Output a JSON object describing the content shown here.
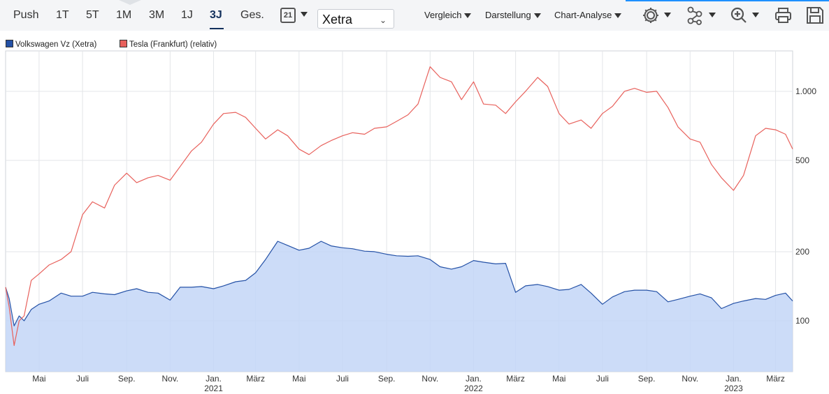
{
  "toolbar": {
    "ranges": [
      "Push",
      "1T",
      "5T",
      "1M",
      "3M",
      "1J",
      "3J",
      "Ges."
    ],
    "active_range": "3J",
    "calendar_day": "21",
    "exchange_select": "Xetra",
    "menus": [
      "Vergleich",
      "Darstellung",
      "Chart-Analyse"
    ]
  },
  "icons": [
    "calendar-icon",
    "settings-gear-icon",
    "indicators-icon",
    "zoom-icon",
    "print-icon",
    "save-icon"
  ],
  "colors": {
    "primary": "#2451a6",
    "comparison": "#e8615c",
    "area_fill": "#c3d6f7",
    "accent": "#1e90ff"
  },
  "chart_data": {
    "type": "line",
    "scale": "log",
    "grid": true,
    "legend_position": "top-left",
    "ylim": [
      60,
      1500
    ],
    "y_ticks": [
      100,
      200,
      500,
      1000
    ],
    "y_tick_labels": [
      "100",
      "200",
      "500",
      "1.000"
    ],
    "x_range": [
      "2020-03-15",
      "2023-03-25"
    ],
    "x_ticks": [
      {
        "date": "2020-05-01",
        "label": "Mai",
        "year": ""
      },
      {
        "date": "2020-07-01",
        "label": "Juli",
        "year": ""
      },
      {
        "date": "2020-09-01",
        "label": "Sep.",
        "year": ""
      },
      {
        "date": "2020-11-01",
        "label": "Nov.",
        "year": ""
      },
      {
        "date": "2021-01-01",
        "label": "Jan.",
        "year": "2021"
      },
      {
        "date": "2021-03-01",
        "label": "März",
        "year": ""
      },
      {
        "date": "2021-05-01",
        "label": "Mai",
        "year": ""
      },
      {
        "date": "2021-07-01",
        "label": "Juli",
        "year": ""
      },
      {
        "date": "2021-09-01",
        "label": "Sep.",
        "year": ""
      },
      {
        "date": "2021-11-01",
        "label": "Nov.",
        "year": ""
      },
      {
        "date": "2022-01-01",
        "label": "Jan.",
        "year": "2022"
      },
      {
        "date": "2022-03-01",
        "label": "März",
        "year": ""
      },
      {
        "date": "2022-05-01",
        "label": "Mai",
        "year": ""
      },
      {
        "date": "2022-07-01",
        "label": "Juli",
        "year": ""
      },
      {
        "date": "2022-09-01",
        "label": "Sep.",
        "year": ""
      },
      {
        "date": "2022-11-01",
        "label": "Nov.",
        "year": ""
      },
      {
        "date": "2023-01-01",
        "label": "Jan.",
        "year": "2023"
      },
      {
        "date": "2023-03-01",
        "label": "März",
        "year": ""
      }
    ],
    "series": [
      {
        "name": "Volkswagen Vz (Xetra)",
        "color": "#2451a6",
        "filled": true,
        "points": [
          [
            "2020-03-15",
            140
          ],
          [
            "2020-03-20",
            125
          ],
          [
            "2020-03-27",
            95
          ],
          [
            "2020-04-03",
            105
          ],
          [
            "2020-04-10",
            100
          ],
          [
            "2020-04-20",
            112
          ],
          [
            "2020-05-01",
            118
          ],
          [
            "2020-05-15",
            122
          ],
          [
            "2020-06-01",
            132
          ],
          [
            "2020-06-15",
            128
          ],
          [
            "2020-07-01",
            128
          ],
          [
            "2020-07-15",
            133
          ],
          [
            "2020-08-01",
            131
          ],
          [
            "2020-08-15",
            130
          ],
          [
            "2020-09-01",
            135
          ],
          [
            "2020-09-15",
            138
          ],
          [
            "2020-10-01",
            133
          ],
          [
            "2020-10-15",
            132
          ],
          [
            "2020-11-01",
            123
          ],
          [
            "2020-11-15",
            140
          ],
          [
            "2020-12-01",
            140
          ],
          [
            "2020-12-15",
            141
          ],
          [
            "2021-01-01",
            138
          ],
          [
            "2021-01-15",
            142
          ],
          [
            "2021-02-01",
            148
          ],
          [
            "2021-02-15",
            150
          ],
          [
            "2021-03-01",
            162
          ],
          [
            "2021-03-15",
            185
          ],
          [
            "2021-04-01",
            222
          ],
          [
            "2021-04-15",
            213
          ],
          [
            "2021-05-01",
            203
          ],
          [
            "2021-05-15",
            207
          ],
          [
            "2021-06-01",
            222
          ],
          [
            "2021-06-15",
            212
          ],
          [
            "2021-07-01",
            208
          ],
          [
            "2021-07-15",
            206
          ],
          [
            "2021-08-01",
            201
          ],
          [
            "2021-08-15",
            200
          ],
          [
            "2021-09-01",
            195
          ],
          [
            "2021-09-15",
            192
          ],
          [
            "2021-10-01",
            191
          ],
          [
            "2021-10-15",
            192
          ],
          [
            "2021-11-01",
            185
          ],
          [
            "2021-11-15",
            172
          ],
          [
            "2021-12-01",
            168
          ],
          [
            "2021-12-15",
            172
          ],
          [
            "2022-01-01",
            183
          ],
          [
            "2022-01-15",
            180
          ],
          [
            "2022-02-01",
            177
          ],
          [
            "2022-02-15",
            178
          ],
          [
            "2022-03-01",
            133
          ],
          [
            "2022-03-15",
            142
          ],
          [
            "2022-04-01",
            144
          ],
          [
            "2022-04-15",
            141
          ],
          [
            "2022-05-01",
            136
          ],
          [
            "2022-05-15",
            137
          ],
          [
            "2022-06-01",
            144
          ],
          [
            "2022-06-15",
            132
          ],
          [
            "2022-07-01",
            118
          ],
          [
            "2022-07-15",
            127
          ],
          [
            "2022-08-01",
            134
          ],
          [
            "2022-08-15",
            136
          ],
          [
            "2022-09-01",
            136
          ],
          [
            "2022-09-15",
            134
          ],
          [
            "2022-10-01",
            121
          ],
          [
            "2022-10-15",
            124
          ],
          [
            "2022-11-01",
            128
          ],
          [
            "2022-11-15",
            131
          ],
          [
            "2022-12-01",
            126
          ],
          [
            "2022-12-15",
            113
          ],
          [
            "2023-01-01",
            119
          ],
          [
            "2023-01-15",
            122
          ],
          [
            "2023-02-01",
            125
          ],
          [
            "2023-02-15",
            124
          ],
          [
            "2023-03-01",
            129
          ],
          [
            "2023-03-15",
            132
          ],
          [
            "2023-03-25",
            122
          ]
        ]
      },
      {
        "name": "Tesla (Frankfurt) (relativ)",
        "color": "#e8615c",
        "filled": false,
        "points": [
          [
            "2020-03-15",
            140
          ],
          [
            "2020-03-20",
            115
          ],
          [
            "2020-03-27",
            78
          ],
          [
            "2020-04-03",
            100
          ],
          [
            "2020-04-10",
            105
          ],
          [
            "2020-04-20",
            150
          ],
          [
            "2020-05-01",
            160
          ],
          [
            "2020-05-15",
            175
          ],
          [
            "2020-06-01",
            185
          ],
          [
            "2020-06-15",
            200
          ],
          [
            "2020-07-01",
            290
          ],
          [
            "2020-07-15",
            330
          ],
          [
            "2020-08-01",
            310
          ],
          [
            "2020-08-15",
            390
          ],
          [
            "2020-09-01",
            440
          ],
          [
            "2020-09-15",
            400
          ],
          [
            "2020-10-01",
            420
          ],
          [
            "2020-10-15",
            430
          ],
          [
            "2020-11-01",
            410
          ],
          [
            "2020-11-15",
            470
          ],
          [
            "2020-12-01",
            550
          ],
          [
            "2020-12-15",
            600
          ],
          [
            "2021-01-01",
            720
          ],
          [
            "2021-01-15",
            800
          ],
          [
            "2021-02-01",
            810
          ],
          [
            "2021-02-15",
            770
          ],
          [
            "2021-03-01",
            690
          ],
          [
            "2021-03-15",
            620
          ],
          [
            "2021-04-01",
            680
          ],
          [
            "2021-04-15",
            640
          ],
          [
            "2021-05-01",
            560
          ],
          [
            "2021-05-15",
            530
          ],
          [
            "2021-06-01",
            580
          ],
          [
            "2021-06-15",
            610
          ],
          [
            "2021-07-01",
            640
          ],
          [
            "2021-07-15",
            660
          ],
          [
            "2021-08-01",
            650
          ],
          [
            "2021-08-15",
            690
          ],
          [
            "2021-09-01",
            700
          ],
          [
            "2021-09-15",
            740
          ],
          [
            "2021-10-01",
            790
          ],
          [
            "2021-10-15",
            880
          ],
          [
            "2021-11-01",
            1280
          ],
          [
            "2021-11-15",
            1150
          ],
          [
            "2021-12-01",
            1100
          ],
          [
            "2021-12-15",
            920
          ],
          [
            "2022-01-01",
            1100
          ],
          [
            "2022-01-15",
            880
          ],
          [
            "2022-02-01",
            870
          ],
          [
            "2022-02-15",
            800
          ],
          [
            "2022-03-01",
            900
          ],
          [
            "2022-03-15",
            1000
          ],
          [
            "2022-04-01",
            1150
          ],
          [
            "2022-04-15",
            1050
          ],
          [
            "2022-05-01",
            800
          ],
          [
            "2022-05-15",
            720
          ],
          [
            "2022-06-01",
            750
          ],
          [
            "2022-06-15",
            690
          ],
          [
            "2022-07-01",
            800
          ],
          [
            "2022-07-15",
            860
          ],
          [
            "2022-08-01",
            1000
          ],
          [
            "2022-08-15",
            1030
          ],
          [
            "2022-09-01",
            990
          ],
          [
            "2022-09-15",
            1000
          ],
          [
            "2022-10-01",
            850
          ],
          [
            "2022-10-15",
            700
          ],
          [
            "2022-11-01",
            620
          ],
          [
            "2022-11-15",
            600
          ],
          [
            "2022-12-01",
            480
          ],
          [
            "2022-12-15",
            420
          ],
          [
            "2023-01-01",
            370
          ],
          [
            "2023-01-15",
            430
          ],
          [
            "2023-02-01",
            640
          ],
          [
            "2023-02-15",
            690
          ],
          [
            "2023-03-01",
            680
          ],
          [
            "2023-03-15",
            650
          ],
          [
            "2023-03-25",
            560
          ]
        ]
      }
    ]
  }
}
